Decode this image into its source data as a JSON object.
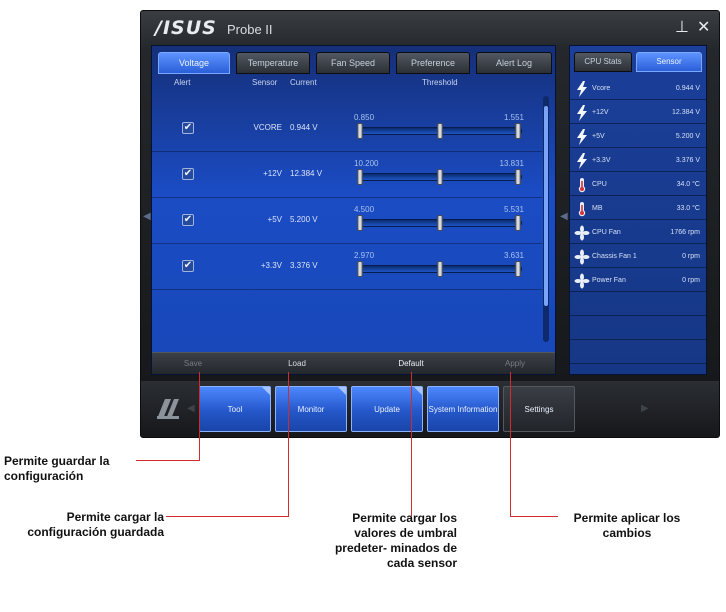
{
  "window": {
    "brand": "/ISUS",
    "title": "Probe II",
    "minimize_glyph": "⊥",
    "close_glyph": "✕"
  },
  "tabs": [
    {
      "label": "Voltage",
      "active": true
    },
    {
      "label": "Temperature",
      "active": false
    },
    {
      "label": "Fan Speed",
      "active": false
    },
    {
      "label": "Preference",
      "active": false
    },
    {
      "label": "Alert Log",
      "active": false
    }
  ],
  "columns": {
    "alert": "Alert",
    "sensor": "Sensor",
    "current": "Current",
    "threshold": "Threshold"
  },
  "sensors": [
    {
      "checked": "✔",
      "name": "VCORE",
      "current": "0.944 V",
      "min": "0.850",
      "max": "1.551"
    },
    {
      "checked": "✔",
      "name": "+12V",
      "current": "12.384 V",
      "min": "10.200",
      "max": "13.831"
    },
    {
      "checked": "✔",
      "name": "+5V",
      "current": "5.200 V",
      "min": "4.500",
      "max": "5.531"
    },
    {
      "checked": "✔",
      "name": "+3.3V",
      "current": "3.376 V",
      "min": "2.970",
      "max": "3.631"
    }
  ],
  "actions": {
    "save": "Save",
    "load": "Load",
    "default": "Default",
    "apply": "Apply"
  },
  "side_tabs": [
    {
      "label": "CPU Stats",
      "active": false
    },
    {
      "label": "Sensor",
      "active": true
    }
  ],
  "side_items": [
    {
      "icon": "lightning-icon",
      "label": "Vcore",
      "value": "0.944 V"
    },
    {
      "icon": "lightning-icon",
      "label": "+12V",
      "value": "12.384 V"
    },
    {
      "icon": "lightning-icon",
      "label": "+5V",
      "value": "5.200 V"
    },
    {
      "icon": "lightning-icon",
      "label": "+3.3V",
      "value": "3.376 V"
    },
    {
      "icon": "thermometer-icon",
      "label": "CPU",
      "value": "34.0 °C"
    },
    {
      "icon": "thermometer-icon",
      "label": "MB",
      "value": "33.0 °C"
    },
    {
      "icon": "fan-icon",
      "label": "CPU Fan",
      "value": "1766 rpm"
    },
    {
      "icon": "fan-icon",
      "label": "Chassis Fan 1",
      "value": "0 rpm"
    },
    {
      "icon": "fan-icon",
      "label": "Power Fan",
      "value": "0 rpm"
    }
  ],
  "dock": [
    {
      "label": "Tool",
      "style": "blue",
      "corner": true
    },
    {
      "label": "Monitor",
      "style": "blue",
      "corner": true
    },
    {
      "label": "Update",
      "style": "blue",
      "corner": true
    },
    {
      "label": "System Information",
      "style": "blue",
      "corner": false
    },
    {
      "label": "Settings",
      "style": "dark",
      "corner": false
    }
  ],
  "callouts": {
    "save": "Permite guardar la configuración",
    "load": "Permite cargar la configuración guardada",
    "default": "Permite cargar los valores de umbral predeter- minados de cada sensor",
    "apply": "Permite aplicar los cambios"
  },
  "colors": {
    "accent": "#2b63e0",
    "callout_line": "#d12b2b",
    "window_bg": "#1a1c20"
  }
}
